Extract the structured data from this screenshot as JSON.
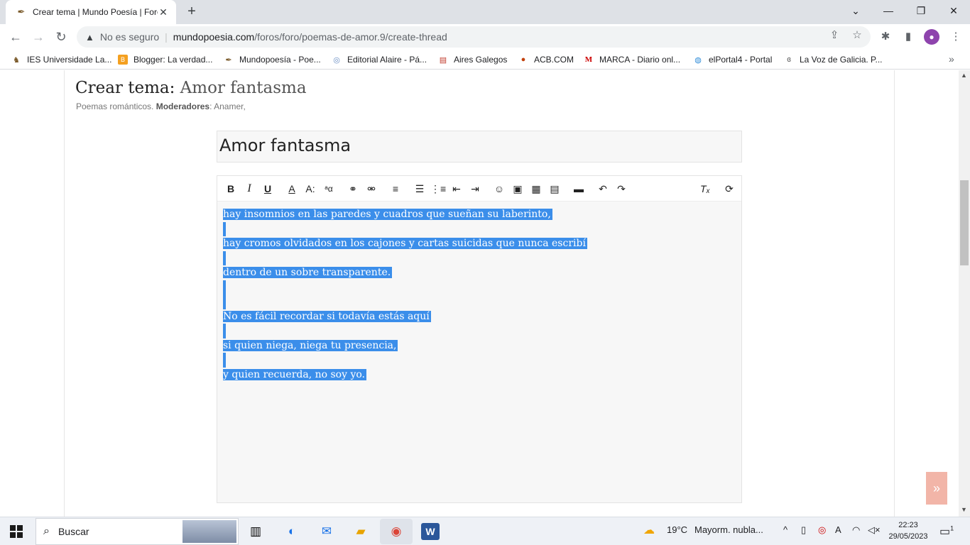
{
  "browser": {
    "tab_title": "Crear tema | Mundo Poesía | Foro",
    "tab_close": "✕",
    "new_tab": "+",
    "security_label": "No es seguro",
    "url_host": "mundopoesia.com",
    "url_path": "/foros/foro/poemas-de-amor.9/create-thread",
    "profile_initial": "●",
    "win_minimize": "⌄",
    "win_min": "—",
    "win_max": "❐",
    "win_close": "✕"
  },
  "bookmarks": [
    {
      "label": "IES Universidade La...",
      "icon": "leaf-icon",
      "glyph": "♞",
      "color": "#7a5a2a"
    },
    {
      "label": "Blogger: La verdad...",
      "icon": "blogger-icon",
      "glyph": "B",
      "color": "#f4a020"
    },
    {
      "label": "Mundopoesía - Poe...",
      "icon": "quill-icon",
      "glyph": "✒",
      "color": "#7a5a2a"
    },
    {
      "label": "Editorial Alaire - Pá...",
      "icon": "globe-icon",
      "glyph": "◎",
      "color": "#6a8ec4"
    },
    {
      "label": "Aires Galegos",
      "icon": "books-icon",
      "glyph": "▤",
      "color": "#c0392b"
    },
    {
      "label": "ACB.COM",
      "icon": "ball-icon",
      "glyph": "●",
      "color": "#c2410c"
    },
    {
      "label": "MARCA - Diario onl...",
      "icon": "marca-icon",
      "glyph": "M",
      "color": "#cc0000"
    },
    {
      "label": "elPortal4 - Portal",
      "icon": "chat-icon",
      "glyph": "◍",
      "color": "#2d8bd8"
    },
    {
      "label": "La Voz de Galicia. P...",
      "icon": "voz-icon",
      "glyph": "ɞ",
      "color": "#555555"
    }
  ],
  "page": {
    "heading_prefix": "Crear tema:",
    "heading_thread": "Amor fantasma",
    "sub_forum": "Poemas románticos.",
    "sub_mods_label": "Moderadores",
    "sub_mods_value": ": Anamer,",
    "title_value": "Amor fantasma"
  },
  "editor": {
    "lines": [
      "hay insomnios en las paredes y cuadros que sueñan su laberinto,",
      "",
      "hay cromos olvidados en los cajones y cartas suicidas que nunca escribí",
      "",
      "dentro de un sobre transparente.",
      "",
      "",
      "No es fácil recordar si todavía estás aquí",
      "",
      "si quien niega, niega tu presencia,",
      "",
      "y quien recuerda, no soy yo."
    ]
  },
  "taskbar": {
    "search_placeholder": "Buscar",
    "weather_temp": "19°C",
    "weather_desc": "Mayorm. nubla...",
    "time": "22:23",
    "date": "29/05/2023",
    "notif_count": "1"
  },
  "colors": {
    "selection": "#3b8eea",
    "backtop": "#f2b5a8"
  }
}
